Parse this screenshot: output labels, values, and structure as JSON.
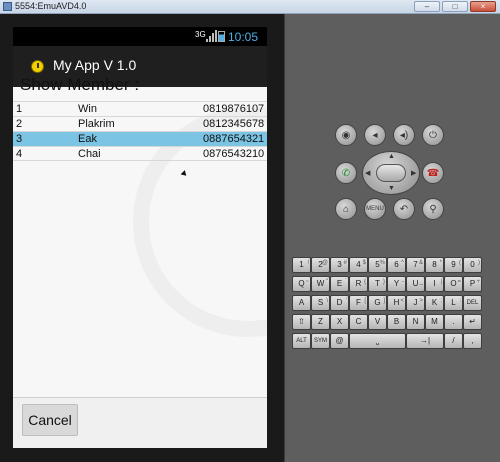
{
  "window": {
    "title": "5554:EmuAVD4.0",
    "controls": {
      "minimize": "–",
      "maximize": "□",
      "close": "×"
    }
  },
  "status_bar": {
    "network": "3G",
    "time": "10:05"
  },
  "app": {
    "title": "My App V 1.0",
    "logo_icon": "app-logo-icon"
  },
  "content": {
    "section_title": "Show Member :",
    "members": [
      {
        "id": "1",
        "name": "Win",
        "phone": "0819876107"
      },
      {
        "id": "2",
        "name": "Plakrim",
        "phone": "0812345678"
      },
      {
        "id": "3",
        "name": "Eak",
        "phone": "0887654321"
      },
      {
        "id": "4",
        "name": "Chai",
        "phone": "0876543210"
      }
    ],
    "selected_index": 2
  },
  "footer": {
    "cancel_label": "Cancel"
  },
  "hardware": {
    "row1": [
      "camera-icon",
      "volume-down-icon",
      "volume-up-icon",
      "power-icon"
    ],
    "row2": [
      "call-icon",
      "dpad",
      "end-call-icon"
    ],
    "row3": [
      "home-icon",
      "menu-label",
      "back-icon",
      "search-icon"
    ],
    "menu_label": "MENU"
  },
  "keyboard": {
    "row1": [
      [
        "1",
        "!"
      ],
      [
        "2",
        "@"
      ],
      [
        "3",
        "#"
      ],
      [
        "4",
        "$"
      ],
      [
        "5",
        "%"
      ],
      [
        "6",
        "^"
      ],
      [
        "7",
        "&"
      ],
      [
        "8",
        "*"
      ],
      [
        "9",
        "("
      ],
      [
        "0",
        ")"
      ]
    ],
    "row2": [
      [
        "Q",
        "~"
      ],
      [
        "W",
        "\""
      ],
      [
        "E",
        "`"
      ],
      [
        "R",
        "{"
      ],
      [
        "T",
        "}"
      ],
      [
        "Y",
        "-"
      ],
      [
        "U",
        "_"
      ],
      [
        "I",
        "|"
      ],
      [
        "O",
        "="
      ],
      [
        "P",
        "+"
      ]
    ],
    "row3": [
      [
        "A",
        ""
      ],
      [
        "S",
        "\\"
      ],
      [
        "D",
        "'"
      ],
      [
        "F",
        "["
      ],
      [
        "G",
        "]"
      ],
      [
        "H",
        "<"
      ],
      [
        "J",
        ">"
      ],
      [
        "K",
        ";"
      ],
      [
        "L",
        ":"
      ],
      [
        "DEL",
        ""
      ]
    ],
    "row4": [
      [
        "⇧",
        ""
      ],
      [
        "Z",
        ""
      ],
      [
        "X",
        ""
      ],
      [
        "C",
        ""
      ],
      [
        "V",
        ""
      ],
      [
        "B",
        ""
      ],
      [
        "N",
        ""
      ],
      [
        "M",
        ""
      ],
      [
        ".",
        ""
      ],
      [
        "↵",
        ""
      ]
    ],
    "row5": [
      [
        "ALT",
        ""
      ],
      [
        "SYM",
        ""
      ],
      [
        "@",
        ""
      ],
      [
        "⎵",
        ""
      ],
      [
        "→|",
        ""
      ],
      [
        "/",
        ""
      ],
      [
        ",",
        ""
      ],
      [
        "ALT",
        ""
      ]
    ]
  },
  "colors": {
    "selection": "#7cc4e3",
    "clock": "#4fb0e4",
    "panel": "#5e5e5e"
  }
}
